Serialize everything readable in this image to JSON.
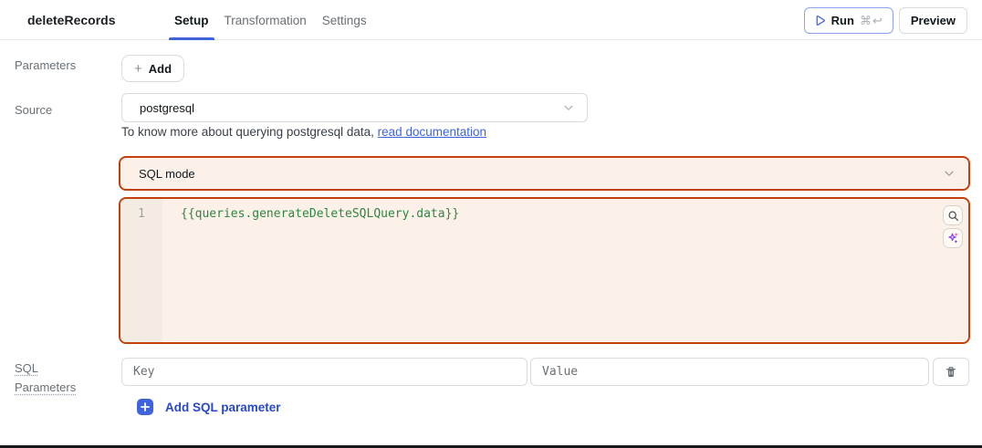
{
  "header": {
    "title": "deleteRecords",
    "tabs": [
      {
        "label": "Setup",
        "active": true
      },
      {
        "label": "Transformation",
        "active": false
      },
      {
        "label": "Settings",
        "active": false
      }
    ],
    "run_label": "Run",
    "run_shortcut": "⌘↩",
    "preview_label": "Preview"
  },
  "parameters": {
    "label": "Parameters",
    "add_icon": "+",
    "add_label": "Add"
  },
  "source": {
    "label": "Source",
    "value": "postgresql",
    "help_prefix": "To know more about querying postgresql data, ",
    "help_link": "read documentation"
  },
  "mode": {
    "value": "SQL mode"
  },
  "editor": {
    "line_number": "1",
    "code": "{{queries.generateDeleteSQLQuery.data}}"
  },
  "sql_parameters": {
    "label": "SQL Parameters",
    "key_placeholder": "Key",
    "value_placeholder": "Value",
    "add_icon": "+",
    "add_label": "Add SQL parameter"
  },
  "colors": {
    "accent_blue": "#3E63DD",
    "run_border_blue": "#8FA3F3",
    "warning_border_orange": "#C2410C",
    "editor_background": "#FBF1E9",
    "gutter_background": "#F4ECE3",
    "code_green": "#2E8540",
    "muted_text": "#687076",
    "dark_text": "#11181C"
  }
}
